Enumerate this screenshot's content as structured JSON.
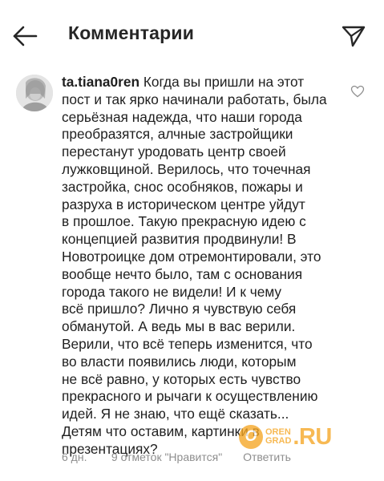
{
  "header": {
    "title": "Комментарии",
    "back_icon": "arrow-left-icon",
    "share_icon": "send-paper-plane-icon"
  },
  "comment": {
    "username": "ta.tiana0ren",
    "lines": [
      " Когда вы пришли на этот",
      "пост и так ярко начинали работать, была",
      "серьёзная надежда, что наши города",
      "преобразятся, алчные застройщики",
      "перестанут уродовать центр своей",
      "лужковщиной. Верилось, что точечная",
      "застройка, снос особняков, пожары и",
      "разруха в историческом центре уйдут",
      "в прошлое. Такую прекрасную идею с",
      "концепцией развития продвинули! В",
      "Новотроицке дом отремонтировали, это",
      "вообще нечто было, там с основания",
      "города такого не видели! И к чему",
      "всё пришло?  Лично я чувствую себя",
      "обманутой. А ведь мы в вас верили.",
      "Верили, что всё теперь изменится, что",
      "во власти появились люди, которым",
      "не всё равно, у которых есть чувство",
      "прекрасного и рычаги к осуществлению",
      "идей. Я не знаю, что ещё сказать...",
      "Детям что оставим, картинки в",
      "презентациях?"
    ],
    "time": "6 дн.",
    "likes": "9 отметок \"Нравится\"",
    "reply": "Ответить",
    "like_icon": "heart-outline-icon"
  },
  "watermark": {
    "letter": "О",
    "small_top": "OREN",
    "small_bottom": "GRAD",
    "big": ".RU",
    "color": "#f5a623"
  }
}
